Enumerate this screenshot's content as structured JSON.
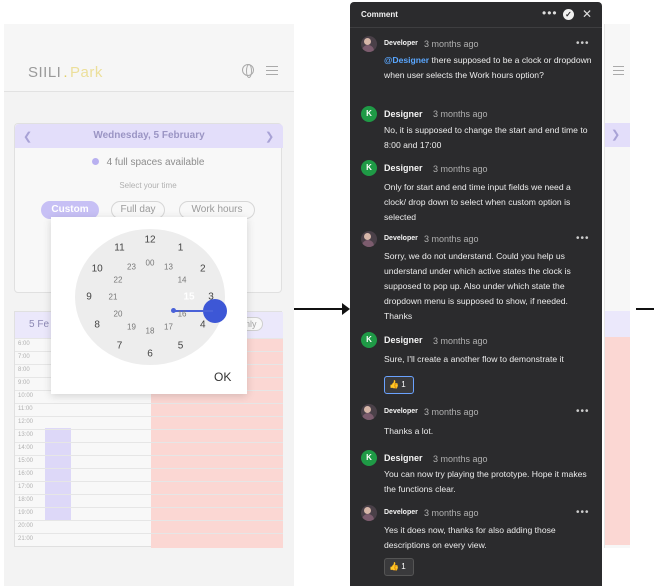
{
  "left_app": {
    "logo": "SIILI",
    "logo_accent": "Park",
    "date_label": "Wednesday, 5 February",
    "availability": "4 full spaces available",
    "select_time_label": "Select your time",
    "chips": [
      "Custom",
      "Full day",
      "Work hours"
    ],
    "schedule_title": "5 Fe",
    "schedule_only": "nly",
    "times": [
      "6:00",
      "7:00",
      "8:00",
      "9:00",
      "10:00",
      "11:00",
      "12:00",
      "13:00",
      "14:00",
      "15:00",
      "16:00",
      "17:00",
      "18:00",
      "19:00",
      "20:00",
      "21:00"
    ]
  },
  "clock": {
    "outer": [
      "12",
      "1",
      "2",
      "3",
      "4",
      "5",
      "6",
      "7",
      "8",
      "9",
      "10",
      "11"
    ],
    "inner": [
      "00",
      "13",
      "14",
      "15",
      "16",
      "17",
      "18",
      "19",
      "20",
      "21",
      "22",
      "23"
    ],
    "selected": "15",
    "ok_label": "OK"
  },
  "panel": {
    "title": "Comment",
    "more": "•••",
    "close": "✕",
    "comments": [
      {
        "author": "Developer",
        "time": "3 months ago",
        "mention": "@Designer",
        "text": " there supposed to be a clock or dropdown when user selects the Work hours option?"
      },
      {
        "author": "Designer",
        "time": "3 months ago",
        "text": "No, it is supposed to change the start and end time to 8:00 and 17:00"
      },
      {
        "author": "Designer",
        "time": "3 months ago",
        "text": "Only for start and end time input fields we need a clock/ drop down to select when custom option is selected"
      },
      {
        "author": "Developer",
        "time": "3 months ago",
        "text": "Sorry, we do not understand. Could you help us understand under which active states the clock is supposed to pop up. Also under which state the dropdown menu is supposed to show, if needed. Thanks"
      },
      {
        "author": "Designer",
        "time": "3 months ago",
        "text": "Sure, I'll create a another flow to demonstrate it",
        "reaction": "👍",
        "reaction_count": "1"
      },
      {
        "author": "Developer",
        "time": "3 months ago",
        "text": "Thanks a lot."
      },
      {
        "author": "Designer",
        "time": "3 months ago",
        "text": "You can now try playing the prototype. Hope it makes the functions clear."
      },
      {
        "author": "Developer",
        "time": "3 months ago",
        "text": "Yes it does now, thanks for also adding those descriptions on every view.",
        "reaction": "👍",
        "reaction_count": "1"
      }
    ],
    "designer_initial": "K"
  }
}
